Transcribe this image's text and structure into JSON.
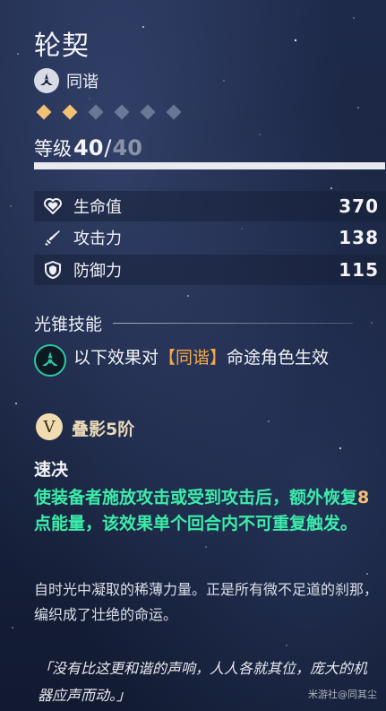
{
  "title": "轮契",
  "path": {
    "label": "同谐",
    "icon": "harmony-path-icon"
  },
  "rarity": {
    "filled": 2,
    "total": 6,
    "color_filled": "#f3c074"
  },
  "level": {
    "label": "等级",
    "current": "40",
    "slash": "/",
    "max": "40",
    "progress": 1.0
  },
  "stats": [
    {
      "icon": "heart-icon",
      "label": "生命值",
      "value": "370"
    },
    {
      "icon": "sword-icon",
      "label": "攻击力",
      "value": "138"
    },
    {
      "icon": "shield-icon",
      "label": "防御力",
      "value": "115"
    }
  ],
  "skill": {
    "header": "光锥技能",
    "desc_prefix": "以下效果对",
    "desc_highlight": "【同谐】",
    "desc_suffix": "命途角色生效",
    "rank_badge": "V",
    "rank_text": "叠影5阶",
    "effect_title": "速决",
    "effect_pre": "使装备者施放攻击或受到攻击后，额外恢复",
    "effect_num": "8",
    "effect_post": "点能量，该效果单个回合内不可重复触发。",
    "highlight_color": "#3cecaa"
  },
  "flavor": "自时光中凝取的稀薄力量。正是所有微不足道的刹那，编织成了壮绝的命运。",
  "quote": "「没有比这更和谐的声响，人人各就其位，庞大的机器应声而动。」",
  "watermark": "米游社@同其尘"
}
